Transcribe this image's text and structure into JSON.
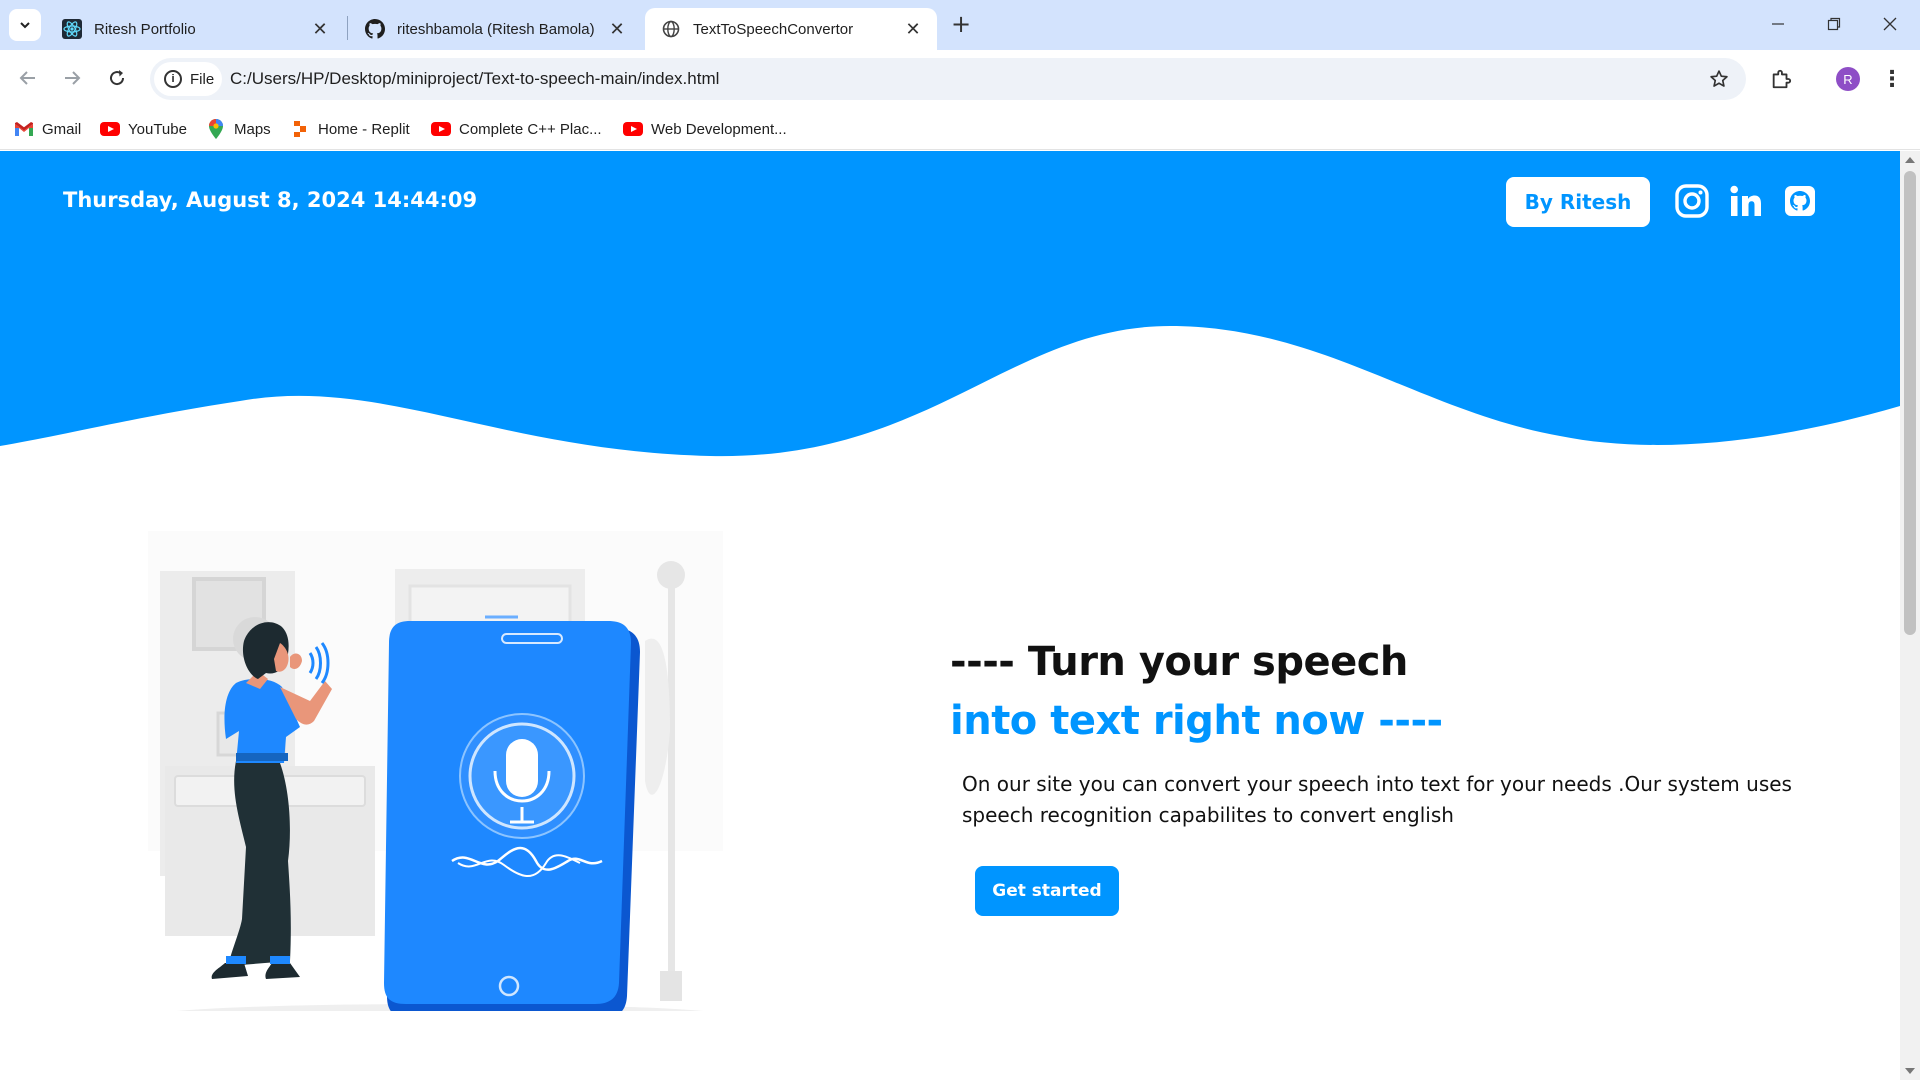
{
  "browser": {
    "tabs": [
      {
        "title": "Ritesh Portfolio",
        "favicon": "react-icon",
        "active": false
      },
      {
        "title": "riteshbamola (Ritesh Bamola)",
        "favicon": "github-icon",
        "active": false
      },
      {
        "title": "TextToSpeechConvertor",
        "favicon": "globe-icon",
        "active": true
      }
    ],
    "address_chip": "File",
    "url": "C:/Users/HP/Desktop/miniproject/Text-to-speech-main/index.html",
    "profile_initial": "R",
    "bookmarks": [
      {
        "label": "Gmail",
        "icon": "gmail-icon"
      },
      {
        "label": "YouTube",
        "icon": "youtube-icon"
      },
      {
        "label": "Maps",
        "icon": "maps-icon"
      },
      {
        "label": "Home - Replit",
        "icon": "replit-icon"
      },
      {
        "label": "Complete C++ Plac...",
        "icon": "youtube-icon"
      },
      {
        "label": "Web Development...",
        "icon": "youtube-icon"
      }
    ]
  },
  "page": {
    "datetime": "Thursday, August 8, 2024 14:44:09",
    "by_button": "By Ritesh",
    "social": [
      "instagram-icon",
      "linkedin-icon",
      "github-icon"
    ],
    "heading_line1": "---- Turn your speech",
    "heading_line2": "into text right now ----",
    "description": "On our site you can convert your speech into text for your needs .Our system uses speech recognition capabilites to convert english",
    "cta": "Get started"
  },
  "colors": {
    "brand_blue": "#0095ff",
    "tabbar": "#d3e3fd"
  }
}
